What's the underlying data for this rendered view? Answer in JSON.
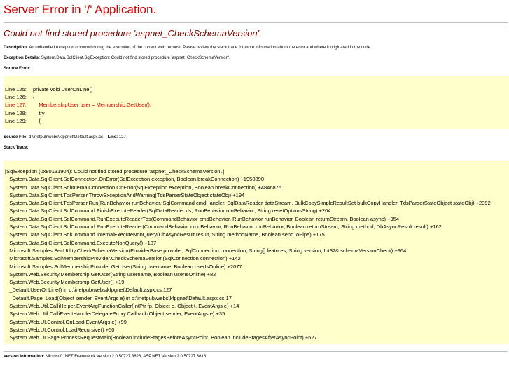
{
  "page": {
    "title": "Server Error in '/' Application.",
    "subtitle": "Could not find stored procedure 'aspnet_CheckSchemaVersion'."
  },
  "description": {
    "label": "Description:",
    "text": "An unhandled exception occurred during the execution of the current web request. Please review the stack trace for more information about the error and where it originated in the code."
  },
  "exception_details": {
    "label": "Exception Details:",
    "text": "System.Data.SqlClient.SqlException: Could not find stored procedure 'aspnet_CheckSchemaVersion'."
  },
  "source_error": {
    "label": "Source Error:",
    "lines": [
      {
        "number": "Line 125:",
        "code": "private void UserOnLine()",
        "error": false
      },
      {
        "number": "Line 126:",
        "code": "{",
        "error": false
      },
      {
        "number": "Line 127:",
        "code": "    MembershipUser user = Membership.GetUser();",
        "error": true
      },
      {
        "number": "Line 128:",
        "code": "    try",
        "error": false
      },
      {
        "number": "Line 129:",
        "code": "    {",
        "error": false
      }
    ]
  },
  "source_file": {
    "label": "Source File:",
    "path": "d:\\inetpub\\webs\\kfpgnet\\Default.aspx.cs",
    "line_label": "Line:",
    "line": "127"
  },
  "stack_trace": {
    "label": "Stack Trace:",
    "lines": [
      "[SqlException (0x80131904): Could not find stored procedure 'aspnet_CheckSchemaVersion'.]",
      "   System.Data.SqlClient.SqlConnection.OnError(SqlException exception, Boolean breakConnection) +1950890",
      "   System.Data.SqlClient.SqlInternalConnection.OnError(SqlException exception, Boolean breakConnection) +4846875",
      "   System.Data.SqlClient.TdsParser.ThrowExceptionAndWarning(TdsParserStateObject stateObj) +194",
      "   System.Data.SqlClient.TdsParser.Run(RunBehavior runBehavior, SqlCommand cmdHandler, SqlDataReader dataStream, BulkCopySimpleResultSet bulkCopyHandler, TdsParserStateObject stateObj) +2392",
      "   System.Data.SqlClient.SqlCommand.FinishExecuteReader(SqlDataReader ds, RunBehavior runBehavior, String resetOptionsString) +204",
      "   System.Data.SqlClient.SqlCommand.RunExecuteReaderTds(CommandBehavior cmdBehavior, RunBehavior runBehavior, Boolean returnStream, Boolean async) +954",
      "   System.Data.SqlClient.SqlCommand.RunExecuteReader(CommandBehavior cmdBehavior, RunBehavior runBehavior, Boolean returnStream, String method, DbAsyncResult result) +162",
      "   System.Data.SqlClient.SqlCommand.InternalExecuteNonQuery(DbAsyncResult result, String methodName, Boolean sendToPipe) +175",
      "   System.Data.SqlClient.SqlCommand.ExecuteNonQuery() +137",
      "   Microsoft.Samples.SecUtility.CheckSchemaVersion(ProviderBase provider, SqlConnection connection, String[] features, String version, Int32& schemaVersionCheck) +964",
      "   Microsoft.Samples.SqlMembershipProvider.CheckSchemaVersion(SqlConnection connection) +142",
      "   Microsoft.Samples.SqlMembershipProvider.GetUser(String username, Boolean userIsOnline) +2077",
      "   System.Web.Security.Membership.GetUser(String username, Boolean userIsOnline) +82",
      "   System.Web.Security.Membership.GetUser() +19",
      "   _Default.UserOnLine() in d:\\inetpub\\webs\\kfpgnet\\Default.aspx.cs:127",
      "   _Default.Page_Load(Object sender, EventArgs e) in d:\\inetpub\\webs\\kfpgnet\\Default.aspx.cs:17",
      "   System.Web.Util.CalliHelper.EventArgFunctionCaller(IntPtr fp, Object o, Object t, EventArgs e) +14",
      "   System.Web.Util.CalliEventHandlerDelegateProxy.Callback(Object sender, EventArgs e) +35",
      "   System.Web.UI.Control.OnLoad(EventArgs e) +99",
      "   System.Web.UI.Control.LoadRecursive() +50",
      "   System.Web.UI.Page.ProcessRequestMain(Boolean includeStagesBeforeAsyncPoint, Boolean includeStagesAfterAsyncPoint) +627"
    ]
  },
  "version_info": {
    "label": "Version Information:",
    "text": "Microsoft .NET Framework Version:2.0.50727.3623; ASP.NET Version:2.0.50727.3618"
  }
}
